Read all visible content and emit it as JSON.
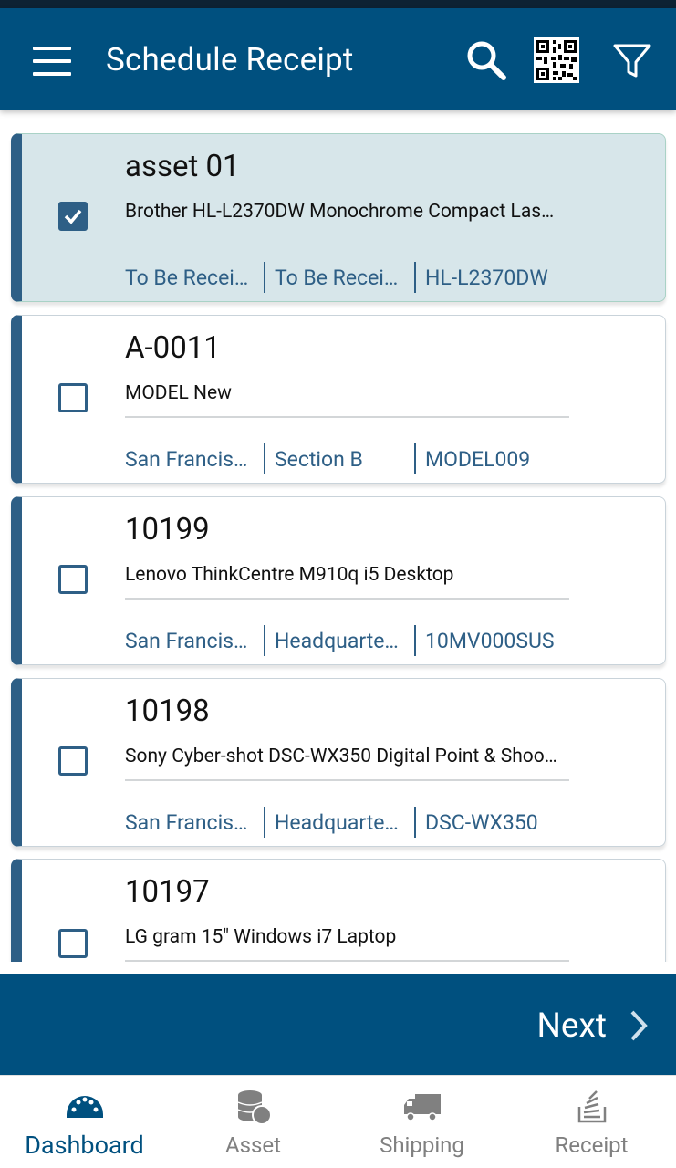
{
  "appbar": {
    "title": "Schedule Receipt",
    "icons": [
      "menu-icon",
      "search-icon",
      "qr-code-icon",
      "filter-icon"
    ]
  },
  "items": [
    {
      "asset": "asset 01",
      "description": "Brother HL-L2370DW Monochrome Compact Las…",
      "meta": [
        "To Be Recei…",
        "To Be Recei…",
        "HL-L2370DW"
      ],
      "checked": true
    },
    {
      "asset": "A-0011",
      "description": "MODEL New",
      "meta": [
        "San Francis…",
        "Section B",
        "MODEL009"
      ],
      "checked": false
    },
    {
      "asset": "10199",
      "description": "Lenovo ThinkCentre M910q i5 Desktop",
      "meta": [
        "San Francis…",
        "Headquarte…",
        "10MV000SUS"
      ],
      "checked": false
    },
    {
      "asset": "10198",
      "description": "Sony Cyber-shot DSC-WX350 Digital Point & Shoo…",
      "meta": [
        "San Francis…",
        "Headquarte…",
        "DSC-WX350"
      ],
      "checked": false
    },
    {
      "asset": "10197",
      "description": "LG gram 15\" Windows i7 Laptop",
      "meta": [
        "",
        "",
        ""
      ],
      "checked": false
    }
  ],
  "footer": {
    "next_label": "Next"
  },
  "bottom_nav": [
    {
      "label": "Dashboard",
      "icon": "dashboard-icon",
      "active": true
    },
    {
      "label": "Asset",
      "icon": "asset-database-icon",
      "active": false
    },
    {
      "label": "Shipping",
      "icon": "shipping-truck-icon",
      "active": false
    },
    {
      "label": "Receipt",
      "icon": "receipt-stack-icon",
      "active": false
    }
  ],
  "colors": {
    "primary": "#00507f",
    "accent": "#2e5f86",
    "selected_bg": "#d7e6ea",
    "inactive": "#808080"
  }
}
